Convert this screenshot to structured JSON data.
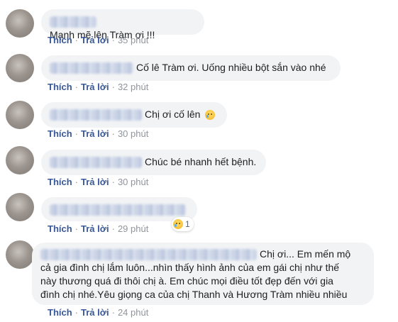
{
  "comments": [
    {
      "text": "Mạnh mẽ lên Tràm ơi !!!",
      "like": "Thích",
      "reply": "Trả lời",
      "time": "35 phút"
    },
    {
      "text": "Cố lê Tràm ơi. Uống nhiều bột sắn vào nhé",
      "like": "Thích",
      "reply": "Trả lời",
      "time": "32 phút"
    },
    {
      "text": "Chị ơi cố lên",
      "emoji": "crying-face-icon",
      "like": "Thích",
      "reply": "Trả lời",
      "time": "30 phút"
    },
    {
      "text": "Chúc bé nhanh hết bệnh.",
      "like": "Thích",
      "reply": "Trả lời",
      "time": "30 phút"
    },
    {
      "text": "",
      "like": "Thích",
      "reply": "Trả lời",
      "time": "29 phút",
      "reaction": {
        "icon": "sad-reaction-icon",
        "count": "1"
      }
    },
    {
      "lines": [
        "Chị ơi... Em mến mộ",
        "cả gia đình chị lắm luôn...nhìn thấy hình ảnh của em gái chị như thế",
        "này thương quá đi thôi chị à. Em chúc mọi điều tốt đẹp đến với gia",
        "đình chị nhé.Yêu giọng ca của chị Thanh và Hương Tràm nhiều nhiều"
      ],
      "like": "Thích",
      "reply": "Trả lời",
      "time": "24 phút"
    }
  ]
}
